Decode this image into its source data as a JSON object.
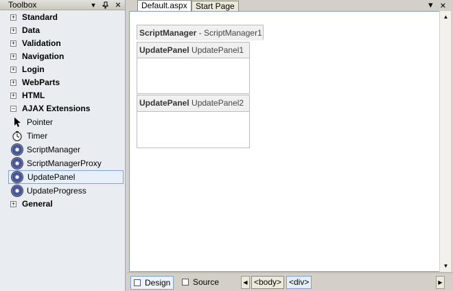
{
  "toolbox": {
    "title": "Toolbox",
    "categories_top": [
      {
        "label": "Standard",
        "expander": "+"
      },
      {
        "label": "Data",
        "expander": "+"
      },
      {
        "label": "Validation",
        "expander": "+"
      },
      {
        "label": "Navigation",
        "expander": "+"
      },
      {
        "label": "Login",
        "expander": "+"
      },
      {
        "label": "WebParts",
        "expander": "+"
      },
      {
        "label": "HTML",
        "expander": "+"
      },
      {
        "label": "AJAX Extensions",
        "expander": "−"
      }
    ],
    "items": [
      {
        "label": "Pointer",
        "icon": "pointer-icon"
      },
      {
        "label": "Timer",
        "icon": "timer-icon"
      },
      {
        "label": "ScriptManager",
        "icon": "gear-icon"
      },
      {
        "label": "ScriptManagerProxy",
        "icon": "gear-icon"
      },
      {
        "label": "UpdatePanel",
        "icon": "gear-icon",
        "selected": true
      },
      {
        "label": "UpdateProgress",
        "icon": "gear-icon"
      }
    ],
    "category_bottom": {
      "label": "General",
      "expander": "+"
    }
  },
  "tabs": [
    {
      "label": "Default.aspx",
      "active": true
    },
    {
      "label": "Start Page",
      "active": false
    }
  ],
  "designer": {
    "script_manager": {
      "type": "ScriptManager",
      "name": " - ScriptManager1"
    },
    "panel1": {
      "type": "UpdatePanel",
      "name": " UpdatePanel1"
    },
    "panel2": {
      "type": "UpdatePanel",
      "name": " UpdatePanel2"
    }
  },
  "bottom": {
    "design_label": "Design",
    "source_label": "Source",
    "tags": [
      "<body>",
      "<div>"
    ]
  }
}
